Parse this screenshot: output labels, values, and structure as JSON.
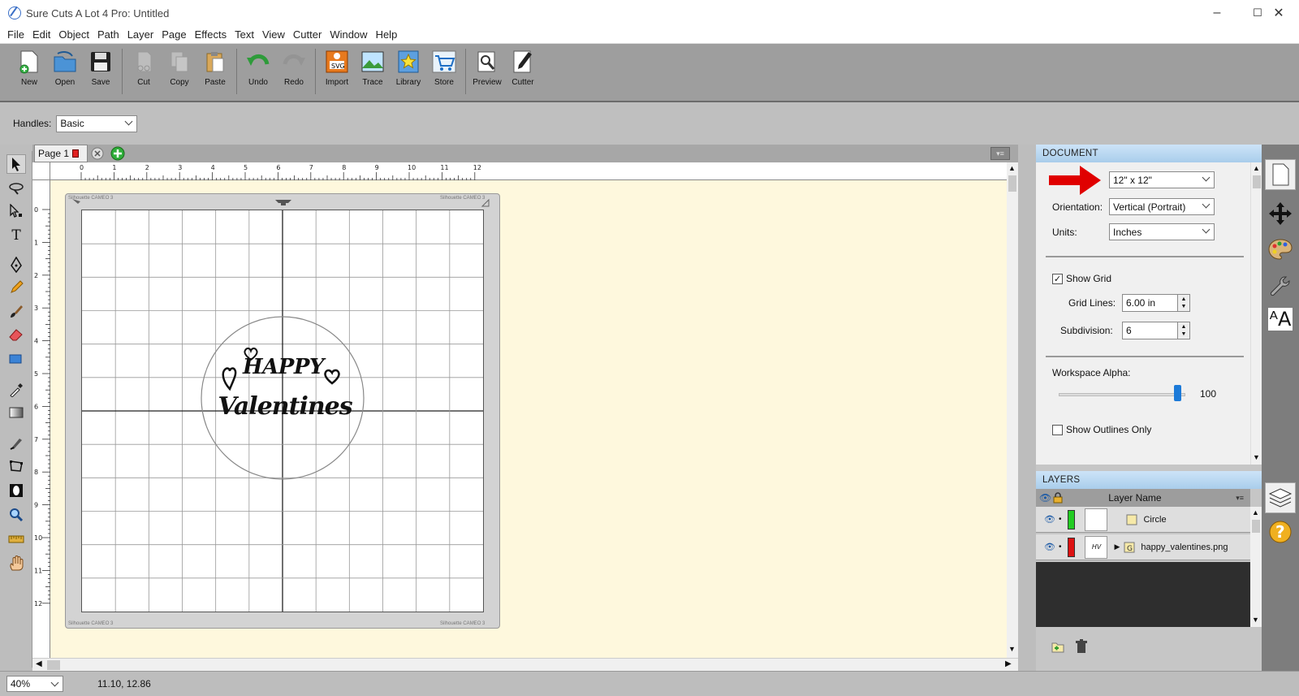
{
  "window": {
    "title": "Sure Cuts A Lot 4 Pro: Untitled",
    "controls": [
      "–",
      "☐",
      "✕"
    ]
  },
  "menu": [
    "File",
    "Edit",
    "Object",
    "Path",
    "Layer",
    "Page",
    "Effects",
    "Text",
    "View",
    "Cutter",
    "Window",
    "Help"
  ],
  "toolbar": [
    {
      "label": "New",
      "icon": "new-document-icon"
    },
    {
      "label": "Open",
      "icon": "open-folder-icon"
    },
    {
      "label": "Save",
      "icon": "floppy-disk-icon"
    },
    {
      "label": "Cut",
      "icon": "scissors-icon"
    },
    {
      "label": "Copy",
      "icon": "copy-icon"
    },
    {
      "label": "Paste",
      "icon": "paste-icon"
    },
    {
      "label": "Undo",
      "icon": "undo-arrow-icon"
    },
    {
      "label": "Redo",
      "icon": "redo-arrow-icon"
    },
    {
      "label": "Import",
      "icon": "svg-import-icon"
    },
    {
      "label": "Trace",
      "icon": "trace-image-icon"
    },
    {
      "label": "Library",
      "icon": "star-library-icon"
    },
    {
      "label": "Store",
      "icon": "shopping-cart-icon"
    },
    {
      "label": "Preview",
      "icon": "magnifier-preview-icon"
    },
    {
      "label": "Cutter",
      "icon": "cutter-blade-icon"
    }
  ],
  "options": {
    "handles_label": "Handles:",
    "handles_value": "Basic"
  },
  "canvas": {
    "page_tab": "Page 1",
    "ruler_h": [
      "0",
      "1",
      "2",
      "3",
      "4",
      "5",
      "6",
      "7",
      "8",
      "9",
      "10",
      "11",
      "12"
    ],
    "ruler_v": [
      "0",
      "1",
      "2",
      "3",
      "4",
      "5",
      "6",
      "7",
      "8",
      "9",
      "10",
      "11",
      "12"
    ],
    "mat_label": "Silhouette CAMEO 3",
    "design_line1": "HAPPY",
    "design_line2": "Valentines"
  },
  "status": {
    "zoom": "40%",
    "coords": "11.10, 12.86"
  },
  "document_panel": {
    "header": "DOCUMENT",
    "size_value": "12\" x 12\"",
    "orientation_label": "Orientation:",
    "orientation_value": "Vertical (Portrait)",
    "units_label": "Units:",
    "units_value": "Inches",
    "show_grid_label": "Show Grid",
    "show_grid_checked": true,
    "grid_lines_label": "Grid Lines:",
    "grid_lines_value": "6.00 in",
    "subdivision_label": "Subdivision:",
    "subdivision_value": "6",
    "workspace_alpha_label": "Workspace Alpha:",
    "workspace_alpha_value": "100",
    "workspace_alpha_fraction": 1.0,
    "show_outlines_label": "Show Outlines Only",
    "show_outlines_checked": false
  },
  "layers_panel": {
    "header": "LAYERS",
    "column_name": "Layer Name",
    "rows": [
      {
        "name": "Circle",
        "color": "#22cc22",
        "thumb": ""
      },
      {
        "name": "happy_valentines.png",
        "color": "#dd1111",
        "thumb": "HV"
      }
    ]
  },
  "colors": {
    "accent_blue": "#1c7ad8",
    "arrow_red": "#e00000",
    "workspace": "#fef8dd"
  }
}
